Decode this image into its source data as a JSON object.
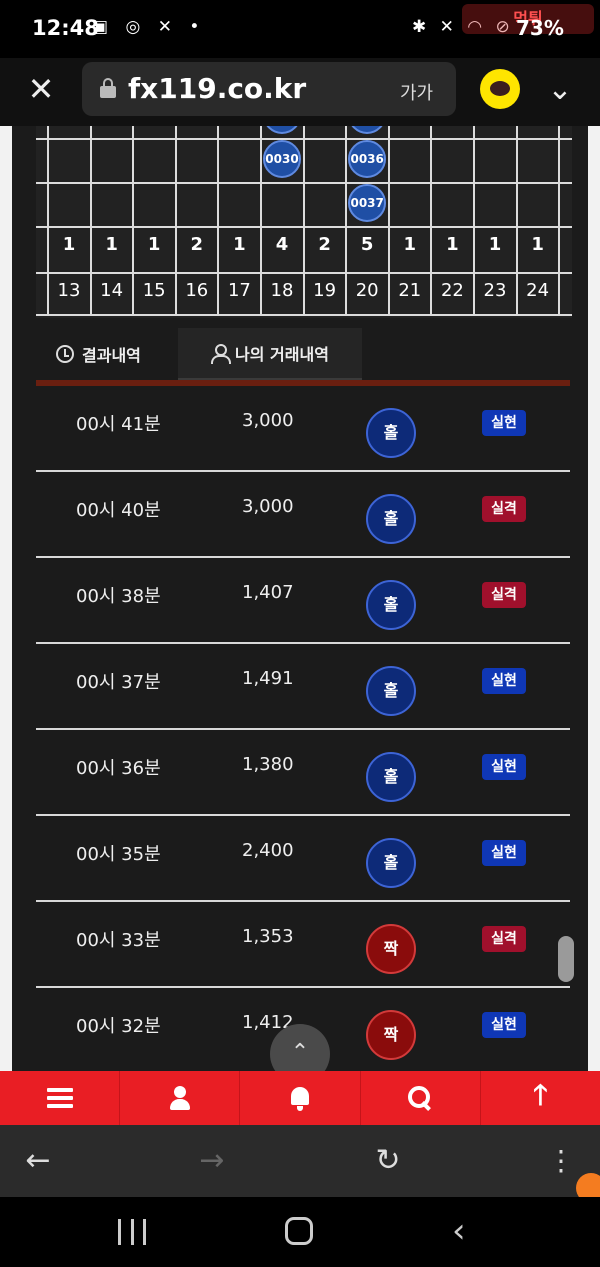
{
  "status_bar": {
    "time": "12:48",
    "left_icons": "▣ ◎ ✕ •",
    "right_icons": "✱ ✕ ◠ ⊘",
    "battery": "73%",
    "watermark": "먹튀"
  },
  "url_bar": {
    "url": "fx119.co.kr",
    "font_size_label": "가가"
  },
  "grid": {
    "chips": [
      {
        "label": "",
        "col": 5,
        "row": -1
      },
      {
        "label": "",
        "col": 7,
        "row": -1
      },
      {
        "label": "0030",
        "col": 5,
        "row": 0
      },
      {
        "label": "0036",
        "col": 7,
        "row": 0
      },
      {
        "label": "0037",
        "col": 7,
        "row": 1
      }
    ],
    "counts": [
      "1",
      "1",
      "1",
      "2",
      "1",
      "4",
      "2",
      "5",
      "1",
      "1",
      "1",
      "1"
    ],
    "hours": [
      "13",
      "14",
      "15",
      "16",
      "17",
      "18",
      "19",
      "20",
      "21",
      "22",
      "23",
      "24"
    ]
  },
  "tabs": {
    "results": "결과내역",
    "mine": "나의 거래내역"
  },
  "history": [
    {
      "time": "00시 41분",
      "amount": "3,000",
      "pick": "홀",
      "pick_type": "odd",
      "result": "실현",
      "result_type": "win"
    },
    {
      "time": "00시 40분",
      "amount": "3,000",
      "pick": "홀",
      "pick_type": "odd",
      "result": "실격",
      "result_type": "lose"
    },
    {
      "time": "00시 38분",
      "amount": "1,407",
      "pick": "홀",
      "pick_type": "odd",
      "result": "실격",
      "result_type": "lose"
    },
    {
      "time": "00시 37분",
      "amount": "1,491",
      "pick": "홀",
      "pick_type": "odd",
      "result": "실현",
      "result_type": "win"
    },
    {
      "time": "00시 36분",
      "amount": "1,380",
      "pick": "홀",
      "pick_type": "odd",
      "result": "실현",
      "result_type": "win"
    },
    {
      "time": "00시 35분",
      "amount": "2,400",
      "pick": "홀",
      "pick_type": "odd",
      "result": "실현",
      "result_type": "win"
    },
    {
      "time": "00시 33분",
      "amount": "1,353",
      "pick": "짝",
      "pick_type": "even",
      "result": "실격",
      "result_type": "lose"
    },
    {
      "time": "00시 32분",
      "amount": "1,412",
      "pick": "짝",
      "pick_type": "even",
      "result": "실현",
      "result_type": "win"
    }
  ],
  "scroll_top_glyph": "⌃",
  "bottom_nav": {
    "up_glyph": "🡑"
  },
  "browser_bar": {
    "back": "←",
    "forward": "→",
    "reload": "↻",
    "more": "⋮"
  },
  "android_nav": {
    "back": "‹"
  },
  "colors": {
    "nav_red": "#e91e24",
    "win_blue": "#0f37b6",
    "lose_red": "#a0102c",
    "odd_chip": "#0d2a78",
    "even_chip": "#8a0c0c"
  }
}
